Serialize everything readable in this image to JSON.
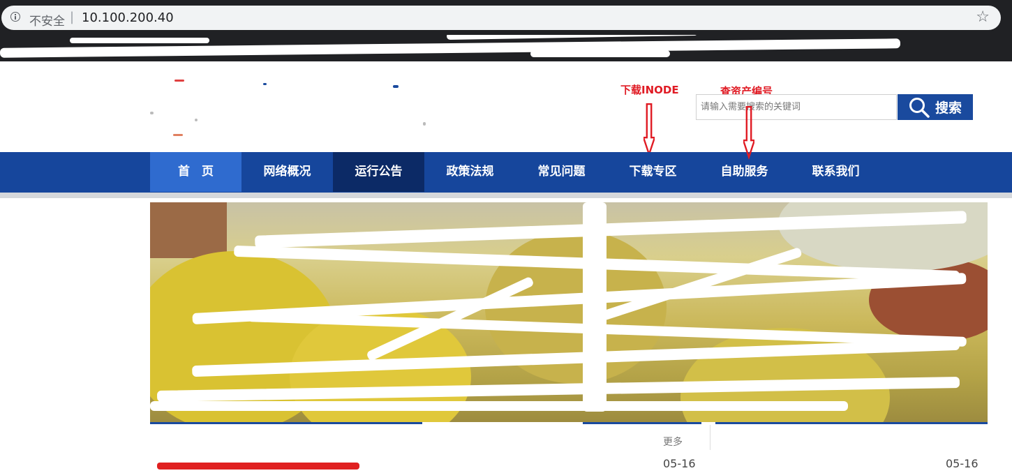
{
  "browser": {
    "security_label": "不安全",
    "separator": "|",
    "url": "10.100.200.40"
  },
  "annotations": {
    "download_inode": "下载INODE",
    "asset_lookup": "查资产编号",
    "color": "#e01b24"
  },
  "search": {
    "placeholder": "请输入需要搜索的关键词",
    "button_label": "搜索"
  },
  "nav": {
    "items": [
      {
        "label": "首　页"
      },
      {
        "label": "网络概况"
      },
      {
        "label": "运行公告"
      },
      {
        "label": "政策法规"
      },
      {
        "label": "常见问题"
      },
      {
        "label": "下载专区"
      },
      {
        "label": "自助服务"
      },
      {
        "label": "联系我们"
      }
    ]
  },
  "lower": {
    "more_label": "更多",
    "date_1": "05-16",
    "date_2": "05-16"
  },
  "colors": {
    "nav_bg": "#16469c",
    "nav_home": "#2f6bcf",
    "nav_active": "#0c2a66",
    "search_button": "#1a4a9e"
  },
  "icons": [
    "info-icon",
    "star-icon",
    "search-icon",
    "down-arrow-icon"
  ]
}
